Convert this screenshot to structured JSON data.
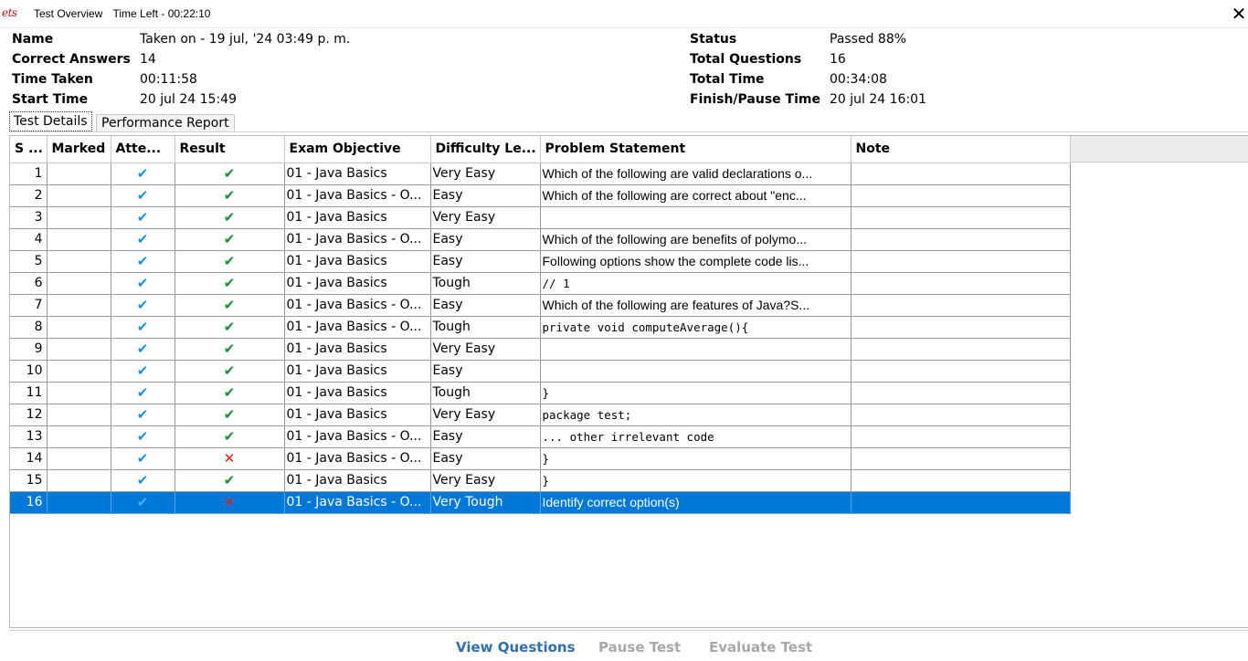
{
  "window": {
    "logo_text": "ets",
    "title": "Test Overview",
    "time_left": "Time Left - 00:22:10",
    "close_glyph": "✕"
  },
  "info_left": [
    {
      "label": "Name",
      "value": "Taken on - 19 jul, '24 03:49 p. m."
    },
    {
      "label": "Correct Answers",
      "value": "14"
    },
    {
      "label": "Time Taken",
      "value": "00:11:58"
    },
    {
      "label": "Start Time",
      "value": "20 jul 24 15:49"
    }
  ],
  "info_right": [
    {
      "label": "Status",
      "value": "Passed 88%"
    },
    {
      "label": "Total Questions",
      "value": "16"
    },
    {
      "label": "Total Time",
      "value": "00:34:08"
    },
    {
      "label": "Finish/Pause Time",
      "value": "20 jul 24 16:01"
    }
  ],
  "tabs": [
    {
      "label": "Test Details",
      "active": true
    },
    {
      "label": "Performance Report",
      "active": false
    }
  ],
  "table": {
    "columns": [
      "S ...",
      "Marked",
      "Atte...",
      "Result",
      "Exam Objective",
      "Difficulty Le...",
      "Problem Statement",
      "Note"
    ],
    "icons": {
      "attempted": "✔",
      "correct": "✔",
      "incorrect": "✕"
    },
    "rows": [
      {
        "s": "1",
        "marked": "",
        "objective": "01 - Java Basics",
        "difficulty": "Very Easy",
        "problem": "Which of the following are valid declarations o...",
        "result": "correct"
      },
      {
        "s": "2",
        "marked": "",
        "objective": "01 - Java Basics - O...",
        "difficulty": "Easy",
        "problem": "Which of the following are correct about \"enc...",
        "result": "correct"
      },
      {
        "s": "3",
        "marked": "",
        "objective": "01 - Java Basics",
        "difficulty": "Very Easy",
        "problem": "",
        "result": "correct"
      },
      {
        "s": "4",
        "marked": "",
        "objective": "01 - Java Basics - O...",
        "difficulty": "Easy",
        "problem": "Which of the following are benefits of polymo...",
        "result": "correct"
      },
      {
        "s": "5",
        "marked": "",
        "objective": "01 - Java Basics",
        "difficulty": "Easy",
        "problem": "Following options show the complete code lis...",
        "result": "correct"
      },
      {
        "s": "6",
        "marked": "",
        "objective": "01 - Java Basics",
        "difficulty": "Tough",
        "problem": "// 1",
        "result": "correct",
        "code": true
      },
      {
        "s": "7",
        "marked": "",
        "objective": "01 - Java Basics - O...",
        "difficulty": "Easy",
        "problem": "Which of the following are features of Java?S...",
        "result": "correct"
      },
      {
        "s": "8",
        "marked": "",
        "objective": "01 - Java Basics - O...",
        "difficulty": "Tough",
        "problem": "    private void computeAverage(){",
        "result": "correct",
        "code": true
      },
      {
        "s": "9",
        "marked": "",
        "objective": "01 - Java Basics",
        "difficulty": "Very Easy",
        "problem": "",
        "result": "correct"
      },
      {
        "s": "10",
        "marked": "",
        "objective": "01 - Java Basics",
        "difficulty": "Easy",
        "problem": "",
        "result": "correct"
      },
      {
        "s": "11",
        "marked": "",
        "objective": "01 - Java Basics",
        "difficulty": "Tough",
        "problem": "}",
        "result": "correct",
        "code": true
      },
      {
        "s": "12",
        "marked": "",
        "objective": "01 - Java Basics",
        "difficulty": "Very Easy",
        "problem": "package test;",
        "result": "correct",
        "code": true
      },
      {
        "s": "13",
        "marked": "",
        "objective": "01 - Java Basics - O...",
        "difficulty": "Easy",
        "problem": "   ... other irrelevant code",
        "result": "correct",
        "code": true
      },
      {
        "s": "14",
        "marked": "",
        "objective": "01 - Java Basics - O...",
        "difficulty": "Easy",
        "problem": "}",
        "result": "incorrect",
        "code": true
      },
      {
        "s": "15",
        "marked": "",
        "objective": "01 - Java Basics",
        "difficulty": "Very Easy",
        "problem": "}",
        "result": "correct",
        "code": true
      },
      {
        "s": "16",
        "marked": "",
        "objective": "01 - Java Basics - O...",
        "difficulty": "Very Tough",
        "problem": "Identify correct option(s)",
        "result": "incorrect",
        "selected": true
      }
    ]
  },
  "footer": {
    "view_questions": "View Questions",
    "pause_test": "Pause Test",
    "evaluate_test": "Evaluate Test"
  },
  "colors": {
    "selection": "#0078d7",
    "attempted_check": "#1e8fe8",
    "correct_check": "#1f8a2e",
    "incorrect_cross": "#e21b1b",
    "active_button": "#2f6fad",
    "disabled_button": "#a8a8a8"
  }
}
